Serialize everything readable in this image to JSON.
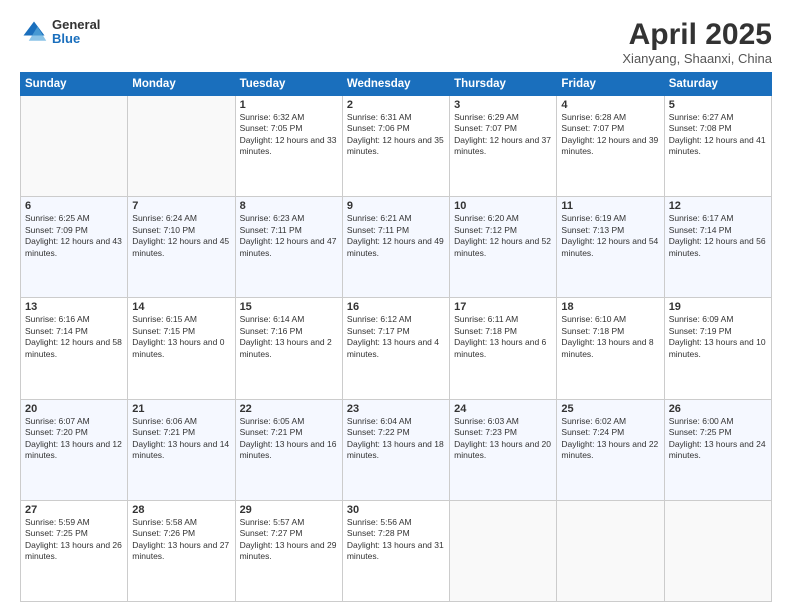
{
  "logo": {
    "general": "General",
    "blue": "Blue"
  },
  "header": {
    "month_title": "April 2025",
    "subtitle": "Xianyang, Shaanxi, China"
  },
  "days_of_week": [
    "Sunday",
    "Monday",
    "Tuesday",
    "Wednesday",
    "Thursday",
    "Friday",
    "Saturday"
  ],
  "weeks": [
    [
      {
        "day": "",
        "sunrise": "",
        "sunset": "",
        "daylight": ""
      },
      {
        "day": "",
        "sunrise": "",
        "sunset": "",
        "daylight": ""
      },
      {
        "day": "1",
        "sunrise": "Sunrise: 6:32 AM",
        "sunset": "Sunset: 7:05 PM",
        "daylight": "Daylight: 12 hours and 33 minutes."
      },
      {
        "day": "2",
        "sunrise": "Sunrise: 6:31 AM",
        "sunset": "Sunset: 7:06 PM",
        "daylight": "Daylight: 12 hours and 35 minutes."
      },
      {
        "day": "3",
        "sunrise": "Sunrise: 6:29 AM",
        "sunset": "Sunset: 7:07 PM",
        "daylight": "Daylight: 12 hours and 37 minutes."
      },
      {
        "day": "4",
        "sunrise": "Sunrise: 6:28 AM",
        "sunset": "Sunset: 7:07 PM",
        "daylight": "Daylight: 12 hours and 39 minutes."
      },
      {
        "day": "5",
        "sunrise": "Sunrise: 6:27 AM",
        "sunset": "Sunset: 7:08 PM",
        "daylight": "Daylight: 12 hours and 41 minutes."
      }
    ],
    [
      {
        "day": "6",
        "sunrise": "Sunrise: 6:25 AM",
        "sunset": "Sunset: 7:09 PM",
        "daylight": "Daylight: 12 hours and 43 minutes."
      },
      {
        "day": "7",
        "sunrise": "Sunrise: 6:24 AM",
        "sunset": "Sunset: 7:10 PM",
        "daylight": "Daylight: 12 hours and 45 minutes."
      },
      {
        "day": "8",
        "sunrise": "Sunrise: 6:23 AM",
        "sunset": "Sunset: 7:11 PM",
        "daylight": "Daylight: 12 hours and 47 minutes."
      },
      {
        "day": "9",
        "sunrise": "Sunrise: 6:21 AM",
        "sunset": "Sunset: 7:11 PM",
        "daylight": "Daylight: 12 hours and 49 minutes."
      },
      {
        "day": "10",
        "sunrise": "Sunrise: 6:20 AM",
        "sunset": "Sunset: 7:12 PM",
        "daylight": "Daylight: 12 hours and 52 minutes."
      },
      {
        "day": "11",
        "sunrise": "Sunrise: 6:19 AM",
        "sunset": "Sunset: 7:13 PM",
        "daylight": "Daylight: 12 hours and 54 minutes."
      },
      {
        "day": "12",
        "sunrise": "Sunrise: 6:17 AM",
        "sunset": "Sunset: 7:14 PM",
        "daylight": "Daylight: 12 hours and 56 minutes."
      }
    ],
    [
      {
        "day": "13",
        "sunrise": "Sunrise: 6:16 AM",
        "sunset": "Sunset: 7:14 PM",
        "daylight": "Daylight: 12 hours and 58 minutes."
      },
      {
        "day": "14",
        "sunrise": "Sunrise: 6:15 AM",
        "sunset": "Sunset: 7:15 PM",
        "daylight": "Daylight: 13 hours and 0 minutes."
      },
      {
        "day": "15",
        "sunrise": "Sunrise: 6:14 AM",
        "sunset": "Sunset: 7:16 PM",
        "daylight": "Daylight: 13 hours and 2 minutes."
      },
      {
        "day": "16",
        "sunrise": "Sunrise: 6:12 AM",
        "sunset": "Sunset: 7:17 PM",
        "daylight": "Daylight: 13 hours and 4 minutes."
      },
      {
        "day": "17",
        "sunrise": "Sunrise: 6:11 AM",
        "sunset": "Sunset: 7:18 PM",
        "daylight": "Daylight: 13 hours and 6 minutes."
      },
      {
        "day": "18",
        "sunrise": "Sunrise: 6:10 AM",
        "sunset": "Sunset: 7:18 PM",
        "daylight": "Daylight: 13 hours and 8 minutes."
      },
      {
        "day": "19",
        "sunrise": "Sunrise: 6:09 AM",
        "sunset": "Sunset: 7:19 PM",
        "daylight": "Daylight: 13 hours and 10 minutes."
      }
    ],
    [
      {
        "day": "20",
        "sunrise": "Sunrise: 6:07 AM",
        "sunset": "Sunset: 7:20 PM",
        "daylight": "Daylight: 13 hours and 12 minutes."
      },
      {
        "day": "21",
        "sunrise": "Sunrise: 6:06 AM",
        "sunset": "Sunset: 7:21 PM",
        "daylight": "Daylight: 13 hours and 14 minutes."
      },
      {
        "day": "22",
        "sunrise": "Sunrise: 6:05 AM",
        "sunset": "Sunset: 7:21 PM",
        "daylight": "Daylight: 13 hours and 16 minutes."
      },
      {
        "day": "23",
        "sunrise": "Sunrise: 6:04 AM",
        "sunset": "Sunset: 7:22 PM",
        "daylight": "Daylight: 13 hours and 18 minutes."
      },
      {
        "day": "24",
        "sunrise": "Sunrise: 6:03 AM",
        "sunset": "Sunset: 7:23 PM",
        "daylight": "Daylight: 13 hours and 20 minutes."
      },
      {
        "day": "25",
        "sunrise": "Sunrise: 6:02 AM",
        "sunset": "Sunset: 7:24 PM",
        "daylight": "Daylight: 13 hours and 22 minutes."
      },
      {
        "day": "26",
        "sunrise": "Sunrise: 6:00 AM",
        "sunset": "Sunset: 7:25 PM",
        "daylight": "Daylight: 13 hours and 24 minutes."
      }
    ],
    [
      {
        "day": "27",
        "sunrise": "Sunrise: 5:59 AM",
        "sunset": "Sunset: 7:25 PM",
        "daylight": "Daylight: 13 hours and 26 minutes."
      },
      {
        "day": "28",
        "sunrise": "Sunrise: 5:58 AM",
        "sunset": "Sunset: 7:26 PM",
        "daylight": "Daylight: 13 hours and 27 minutes."
      },
      {
        "day": "29",
        "sunrise": "Sunrise: 5:57 AM",
        "sunset": "Sunset: 7:27 PM",
        "daylight": "Daylight: 13 hours and 29 minutes."
      },
      {
        "day": "30",
        "sunrise": "Sunrise: 5:56 AM",
        "sunset": "Sunset: 7:28 PM",
        "daylight": "Daylight: 13 hours and 31 minutes."
      },
      {
        "day": "",
        "sunrise": "",
        "sunset": "",
        "daylight": ""
      },
      {
        "day": "",
        "sunrise": "",
        "sunset": "",
        "daylight": ""
      },
      {
        "day": "",
        "sunrise": "",
        "sunset": "",
        "daylight": ""
      }
    ]
  ]
}
